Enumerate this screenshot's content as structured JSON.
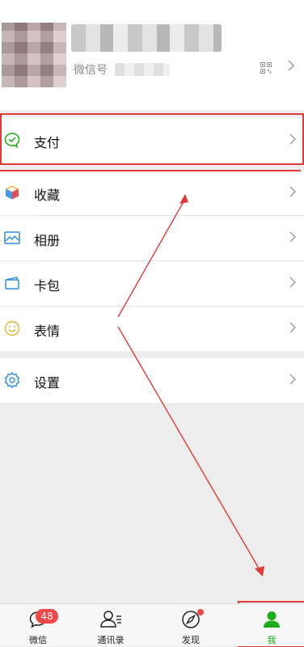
{
  "profile": {
    "wechat_id_label": "微信号"
  },
  "menu": {
    "pay": "支付",
    "favorites": "收藏",
    "album": "相册",
    "cards": "卡包",
    "stickers": "表情",
    "settings": "设置"
  },
  "tabbar": {
    "chats": "微信",
    "chats_badge": "48",
    "contacts": "通讯录",
    "discover": "发现",
    "me": "我"
  },
  "colors": {
    "accent_green": "#1aad19",
    "badge_red": "#f04747",
    "annotation_red": "#e03a3a"
  }
}
